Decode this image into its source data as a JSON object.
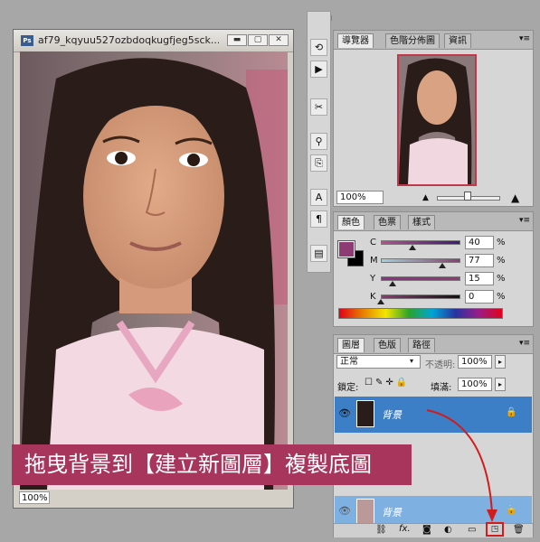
{
  "document": {
    "title": "af79_kqyuu527ozbdoqkugfjeg5sck...",
    "zoom": "100%",
    "ps_badge": "Ps",
    "btn_minimize": "▬",
    "btn_maximize": "▢",
    "btn_close": "✕"
  },
  "top_strip": {
    "collapse": "◀◀"
  },
  "navigator": {
    "tabs": [
      "導覽器",
      "色階分佈圖",
      "資訊"
    ],
    "zoom": "100%"
  },
  "color": {
    "tabs": [
      "顏色",
      "色票",
      "樣式"
    ],
    "rows": [
      {
        "label": "C",
        "value": "40",
        "unit": "%",
        "level": 0.4
      },
      {
        "label": "M",
        "value": "77",
        "unit": "%",
        "level": 0.77
      },
      {
        "label": "Y",
        "value": "15",
        "unit": "%",
        "level": 0.15
      },
      {
        "label": "K",
        "value": "0",
        "unit": "%",
        "level": 0.0
      }
    ],
    "swatch_fg": "#8e3a73",
    "swatch_bg": "#000000"
  },
  "layers": {
    "tabs": [
      "圖層",
      "色版",
      "路徑"
    ],
    "blend_mode": "正常",
    "opacity_label": "不透明:",
    "opacity_value": "100%",
    "lock_label": "鎖定:",
    "fill_label": "填滿:",
    "fill_value": "100%",
    "layer_top": "背景",
    "layer_bottom": "背景"
  },
  "caption": "拖曳背景到【建立新圖層】複製底圖",
  "colors": {
    "accent": "#a8365c",
    "layer_selected": "#3c7fc6",
    "layer_drag": "#7eb0e2"
  }
}
